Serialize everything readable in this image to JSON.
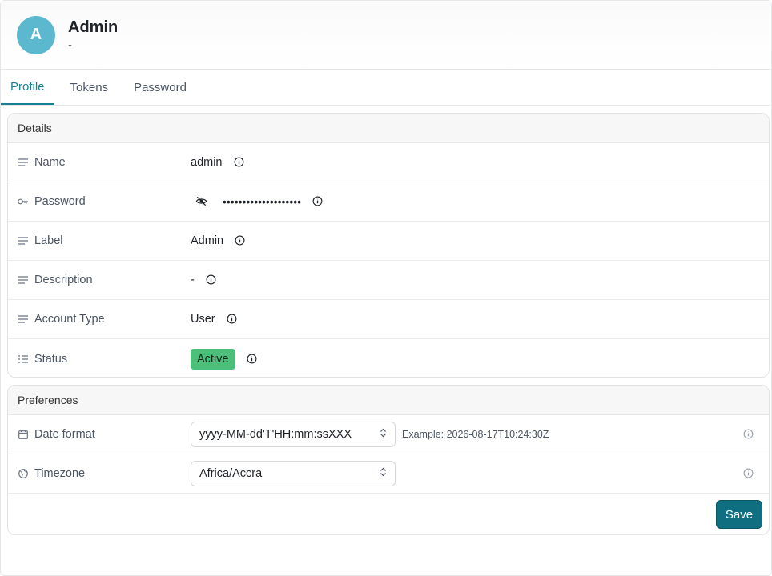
{
  "header": {
    "avatar_letter": "A",
    "title": "Admin",
    "subtitle": "-"
  },
  "tabs": [
    {
      "label": "Profile",
      "active": true
    },
    {
      "label": "Tokens",
      "active": false
    },
    {
      "label": "Password",
      "active": false
    }
  ],
  "details": {
    "title": "Details",
    "name": {
      "label": "Name",
      "value": "admin"
    },
    "password": {
      "label": "Password",
      "value": "••••••••••••••••••••"
    },
    "label": {
      "label": "Label",
      "value": "Admin"
    },
    "description": {
      "label": "Description",
      "value": "-"
    },
    "account_type": {
      "label": "Account Type",
      "value": "User"
    },
    "status": {
      "label": "Status",
      "value": "Active",
      "color": "#4cbf7a"
    }
  },
  "preferences": {
    "title": "Preferences",
    "date_format": {
      "label": "Date format",
      "value": "yyyy-MM-dd'T'HH:mm:ssXXX",
      "example": "Example: 2026-08-17T10:24:30Z"
    },
    "timezone": {
      "label": "Timezone",
      "value": "Africa/Accra"
    },
    "save_label": "Save"
  },
  "colors": {
    "accent": "#1a7f94",
    "save_button": "#0f6e7f",
    "avatar": "#5bb8cf"
  }
}
